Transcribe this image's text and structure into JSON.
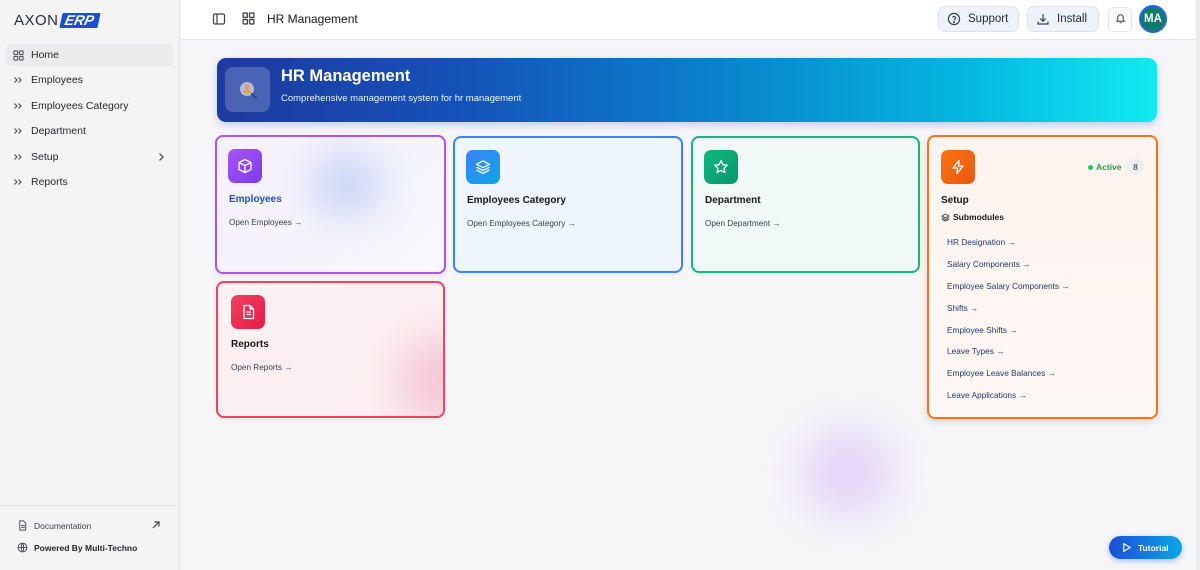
{
  "brand": {
    "axon": "AXON",
    "erp": "ERP"
  },
  "sidebar": {
    "items": [
      {
        "label": "Home",
        "icon": "grid-icon",
        "active": true
      },
      {
        "label": "Employees",
        "icon": "chevrons-right-icon"
      },
      {
        "label": "Employees Category",
        "icon": "chevrons-right-icon"
      },
      {
        "label": "Department",
        "icon": "chevrons-right-icon"
      },
      {
        "label": "Setup",
        "icon": "chevrons-right-icon",
        "expandable": true
      },
      {
        "label": "Reports",
        "icon": "chevrons-right-icon"
      }
    ],
    "footer": {
      "documentation": "Documentation",
      "powered_by": "Powered By Multi-Techno"
    }
  },
  "header": {
    "title": "HR Management",
    "support_label": "Support",
    "install_label": "Install",
    "avatar_initials": "MA"
  },
  "banner": {
    "title": "HR Management",
    "subtitle": "Comprehensive management system for hr management"
  },
  "cards": {
    "employees": {
      "title": "Employees",
      "link": "Open Employees →",
      "icon": "cube-icon"
    },
    "employees_category": {
      "title": "Employees Category",
      "link": "Open Employees Category →",
      "icon": "layers-icon"
    },
    "department": {
      "title": "Department",
      "link": "Open Department →",
      "icon": "star-icon"
    },
    "reports": {
      "title": "Reports",
      "link": "Open Reports →",
      "icon": "document-icon"
    },
    "setup": {
      "title": "Setup",
      "status": "Active",
      "count": "8",
      "submodules_label": "Submodules",
      "icon": "lightning-icon",
      "submodules": [
        "HR Designation →",
        "Salary Components →",
        "Employee Salary Components →",
        "Shifts →",
        "Employee Shifts →",
        "Leave Types →",
        "Employee Leave Balances →",
        "Leave Applications →"
      ]
    }
  },
  "tutorial_label": "Tutorial",
  "colors": {
    "accent": "#1d4ed8",
    "employees": "#a855f7",
    "employees_category": "#3b82f6",
    "department": "#10b981",
    "reports": "#f43f5e",
    "setup": "#f97316"
  }
}
